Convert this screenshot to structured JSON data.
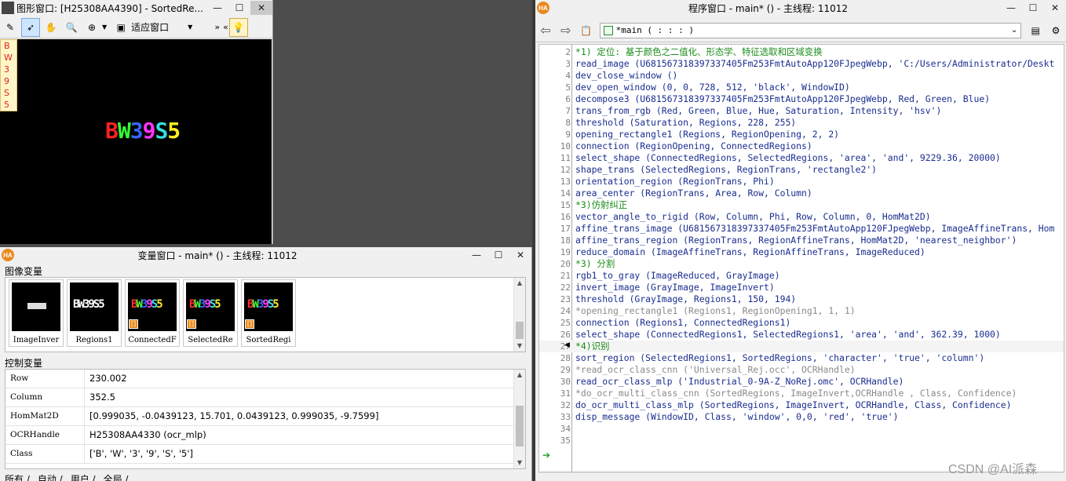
{
  "graphics_window": {
    "title": "图形窗口: [H25308AA4390] - SortedRe...",
    "toolbar": {
      "fit_label": "适应窗口"
    },
    "side_letters": [
      "B",
      "W",
      "3",
      "9",
      "S",
      "5"
    ],
    "canvas_chars": [
      {
        "ch": "B",
        "color": "#ff2020"
      },
      {
        "ch": "W",
        "color": "#33ff33"
      },
      {
        "ch": "3",
        "color": "#3366ff"
      },
      {
        "ch": "9",
        "color": "#ff33ff"
      },
      {
        "ch": "S",
        "color": "#33dddd"
      },
      {
        "ch": "5",
        "color": "#ffee22"
      }
    ]
  },
  "variable_window": {
    "title": "变量窗口 - main* () - 主线程: 11012",
    "image_section_label": "图像变量",
    "control_section_label": "控制变量",
    "thumbnails": [
      {
        "label": "ImageInver",
        "badge": ""
      },
      {
        "label": "Regions1",
        "badge": ""
      },
      {
        "label": "ConnectedF",
        "badge": "[]"
      },
      {
        "label": "SelectedRe",
        "badge": "[]"
      },
      {
        "label": "SortedRegi",
        "badge": "[]"
      }
    ],
    "controls": [
      {
        "name": "Row",
        "value": "230.002"
      },
      {
        "name": "Column",
        "value": "352.5"
      },
      {
        "name": "HomMat2D",
        "value": "[0.999035, -0.0439123, 15.701, 0.0439123, 0.999035, -9.7599]"
      },
      {
        "name": "OCRHandle",
        "value": "H25308AA4330 (ocr_mlp)"
      },
      {
        "name": "Class",
        "value": "['B', 'W', '3', '9', 'S', '5']"
      }
    ],
    "tabs": [
      "所有",
      "自动",
      "用户",
      "全局"
    ]
  },
  "program_window": {
    "title": "程序窗口 - main* () - 主线程: 11012",
    "procedure_select": "*main ( : : : )",
    "lines": [
      {
        "n": "2",
        "text": "*1) 定位: 基于颜色之二值化、形态学、特征选取和区域变换",
        "kind": "comment"
      },
      {
        "n": "3",
        "text": "read_image (U681567318397337405Fm253FmtAutoApp120FJpegWebp, 'C:/Users/Administrator/Deskt",
        "kind": "code"
      },
      {
        "n": "4",
        "text": "dev_close_window ()",
        "kind": "code"
      },
      {
        "n": "5",
        "text": "dev_open_window (0, 0, 728, 512, 'black', WindowID)",
        "kind": "code"
      },
      {
        "n": "6",
        "text": "decompose3 (U681567318397337405Fm253FmtAutoApp120FJpegWebp, Red, Green, Blue)",
        "kind": "code"
      },
      {
        "n": "7",
        "text": "trans_from_rgb (Red, Green, Blue, Hue, Saturation, Intensity, 'hsv')",
        "kind": "code"
      },
      {
        "n": "8",
        "text": "threshold (Saturation, Regions, 228, 255)",
        "kind": "code"
      },
      {
        "n": "9",
        "text": "opening_rectangle1 (Regions, RegionOpening, 2, 2)",
        "kind": "code"
      },
      {
        "n": "10",
        "text": "connection (RegionOpening, ConnectedRegions)",
        "kind": "code"
      },
      {
        "n": "11",
        "text": "select_shape (ConnectedRegions, SelectedRegions, 'area', 'and', 9229.36, 20000)",
        "kind": "code"
      },
      {
        "n": "12",
        "text": "shape_trans (SelectedRegions, RegionTrans, 'rectangle2')",
        "kind": "code"
      },
      {
        "n": "13",
        "text": "orientation_region (RegionTrans, Phi)",
        "kind": "code"
      },
      {
        "n": "14",
        "text": "area_center (RegionTrans, Area, Row, Column)",
        "kind": "code"
      },
      {
        "n": "15",
        "text": "*3)仿射纠正",
        "kind": "comment"
      },
      {
        "n": "16",
        "text": "vector_angle_to_rigid (Row, Column, Phi, Row, Column, 0, HomMat2D)",
        "kind": "code"
      },
      {
        "n": "17",
        "text": "affine_trans_image (U681567318397337405Fm253FmtAutoApp120FJpegWebp, ImageAffineTrans, Hom",
        "kind": "code"
      },
      {
        "n": "18",
        "text": "affine_trans_region (RegionTrans, RegionAffineTrans, HomMat2D, 'nearest_neighbor')",
        "kind": "code"
      },
      {
        "n": "19",
        "text": "reduce_domain (ImageAffineTrans, RegionAffineTrans, ImageReduced)",
        "kind": "code"
      },
      {
        "n": "20",
        "text": "*3) 分割",
        "kind": "comment"
      },
      {
        "n": "21",
        "text": "rgb1_to_gray (ImageReduced, GrayImage)",
        "kind": "code"
      },
      {
        "n": "22",
        "text": "invert_image (GrayImage, ImageInvert)",
        "kind": "code"
      },
      {
        "n": "23",
        "text": "threshold (GrayImage, Regions1, 150, 194)",
        "kind": "code"
      },
      {
        "n": "24",
        "text": "*opening_rectangle1 (Regions1, RegionOpening1, 1, 1)",
        "kind": "disabled"
      },
      {
        "n": "25",
        "text": "connection (Regions1, ConnectedRegions1)",
        "kind": "code"
      },
      {
        "n": "26",
        "text": "select_shape (ConnectedRegions1, SelectedRegions1, 'area', 'and', 362.39, 1000)",
        "kind": "code"
      },
      {
        "n": "27",
        "text": "*4)识别",
        "kind": "comment"
      },
      {
        "n": "28",
        "text": "sort_region (SelectedRegions1, SortedRegions, 'character', 'true', 'column')",
        "kind": "code"
      },
      {
        "n": "29",
        "text": "*read_ocr_class_cnn ('Universal_Rej.occ', OCRHandle)",
        "kind": "disabled"
      },
      {
        "n": "30",
        "text": "read_ocr_class_mlp ('Industrial_0-9A-Z_NoRej.omc', OCRHandle)",
        "kind": "code"
      },
      {
        "n": "31",
        "text": "*do_ocr_multi_class_cnn (SortedRegions, ImageInvert,OCRHandle , Class, Confidence)",
        "kind": "disabled"
      },
      {
        "n": "32",
        "text": "do_ocr_multi_class_mlp (SortedRegions, ImageInvert, OCRHandle, Class, Confidence)",
        "kind": "code"
      },
      {
        "n": "33",
        "text": "disp_message (WindowID, Class, 'window', 0,0, 'red', 'true')",
        "kind": "code"
      },
      {
        "n": "34",
        "text": "",
        "kind": "code"
      },
      {
        "n": "35",
        "text": "",
        "kind": "code"
      }
    ]
  },
  "watermark": "CSDN @AI派森"
}
